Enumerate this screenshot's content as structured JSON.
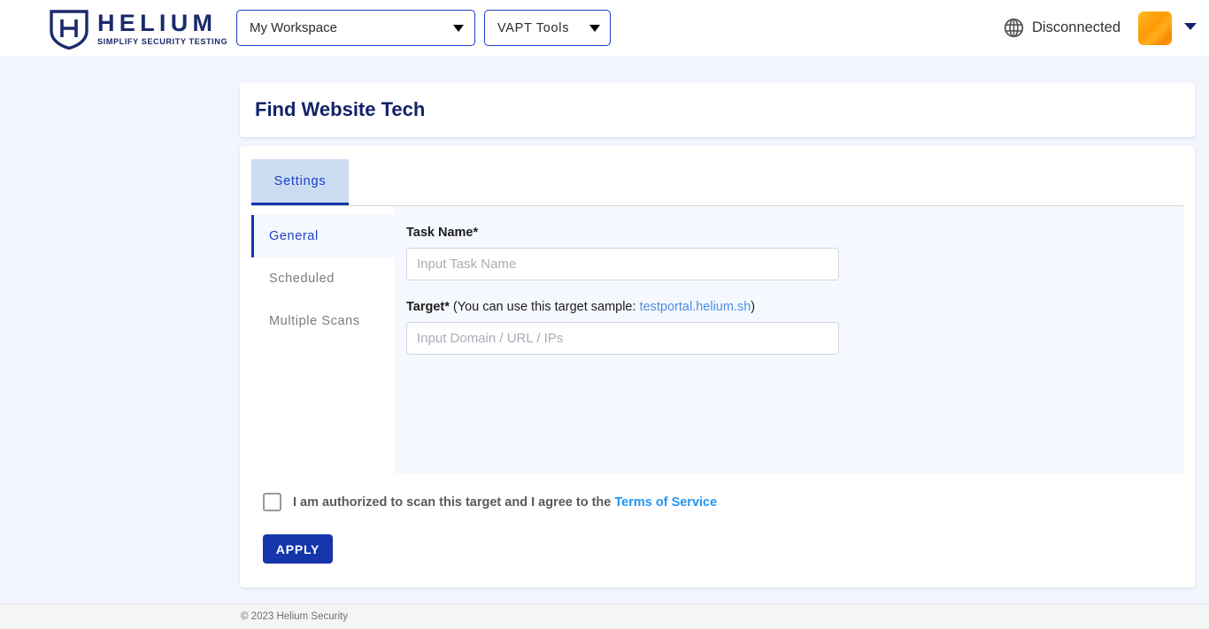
{
  "header": {
    "logo": {
      "icon": "shield-h-icon",
      "name": "HELIUM",
      "tagline": "SIMPLIFY SECURITY TESTING"
    },
    "workspace_select": {
      "value": "My Workspace",
      "caret_icon": "chevron-down-icon"
    },
    "tools_select": {
      "value": "VAPT Tools",
      "caret_icon": "chevron-down-icon"
    },
    "connection": {
      "icon": "globe-icon",
      "status": "Disconnected"
    },
    "avatar": {
      "icon": "user-avatar",
      "color": "#ff9e0a"
    },
    "avatar_caret_icon": "chevron-down-icon"
  },
  "page": {
    "title": "Find Website Tech"
  },
  "tabs": [
    {
      "label": "Settings",
      "active": true
    }
  ],
  "side_nav": {
    "items": [
      {
        "label": "General",
        "active": true
      },
      {
        "label": "Scheduled",
        "active": false
      },
      {
        "label": "Multiple Scans",
        "active": false
      }
    ]
  },
  "form": {
    "task_name": {
      "label": "Task Name*",
      "value": "",
      "placeholder": "Input Task Name"
    },
    "target": {
      "label_bold": "Target*",
      "label_rest": " (You can use this target sample: ",
      "sample_link": "testportal.helium.sh",
      "label_close": ")",
      "value": "",
      "placeholder": "Input Domain / URL / IPs"
    }
  },
  "consent": {
    "checked": false,
    "text": "I am authorized to scan this target and I agree to the ",
    "link": "Terms of Service"
  },
  "apply_button": {
    "label": "APPLY"
  },
  "footer": {
    "text": "© 2023 Helium Security"
  },
  "colors": {
    "brand_navy": "#122368",
    "brand_blue": "#1535ab",
    "link_blue": "#2196f3",
    "page_bg": "#f2f5fd",
    "panel_bg": "#f5f8fe"
  }
}
